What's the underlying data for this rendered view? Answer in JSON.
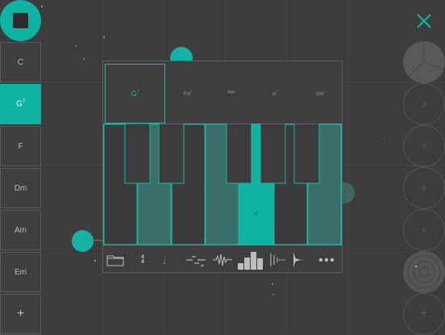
{
  "sidebar": {
    "items": [
      {
        "label": "C",
        "active": false
      },
      {
        "label": "G7",
        "active": true
      },
      {
        "label": "F",
        "active": false
      },
      {
        "label": "Dm",
        "active": false
      },
      {
        "label": "Am",
        "active": false
      },
      {
        "label": "Em",
        "active": false
      },
      {
        "label": "+",
        "active": false
      }
    ]
  },
  "right_column": {
    "circles": [
      "",
      "3",
      "4",
      "5",
      "6",
      "",
      "+"
    ]
  },
  "panel": {
    "chords": [
      {
        "label": "G7",
        "selected": true
      },
      {
        "label": "Fm7",
        "selected": false
      },
      {
        "label": "Am",
        "selected": false
      },
      {
        "label": "A7",
        "selected": false
      },
      {
        "label": "Dm7",
        "selected": false
      }
    ],
    "key_label": "G",
    "toolbar": [
      "folder-icon",
      "time-signature-icon",
      "note-icon",
      "arpeggio-icon",
      "wave-icon",
      "bars-icon",
      "strum-icon",
      "envelope-icon",
      "more-icon"
    ],
    "time_signature": "4/4"
  },
  "colors": {
    "accent": "#0fb3a4",
    "background": "#3d3d3d",
    "key_highlight": "#3a6f69"
  }
}
